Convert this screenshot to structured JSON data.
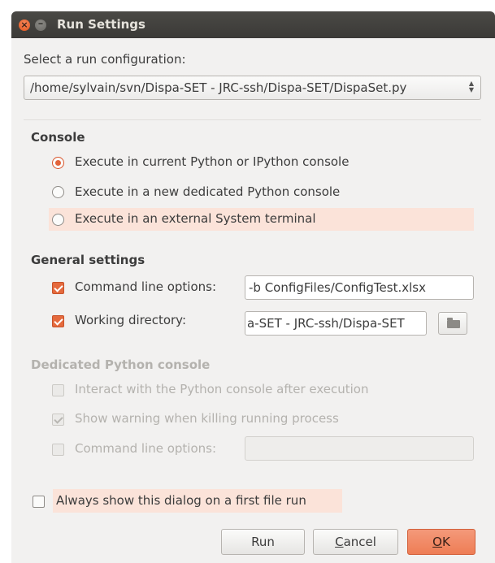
{
  "window": {
    "title": "Run Settings",
    "close_glyph": "×",
    "minimize_glyph": "–"
  },
  "run_config": {
    "label": "Select a run configuration:",
    "selected": "/home/sylvain/svn/Dispa-SET - JRC-ssh/Dispa-SET/DispaSet.py"
  },
  "console": {
    "title": "Console",
    "options": [
      {
        "label": "Execute in current Python or IPython console",
        "checked": true
      },
      {
        "label": "Execute in a new dedicated Python console",
        "checked": false
      },
      {
        "label": "Execute in an external System terminal",
        "checked": false
      }
    ]
  },
  "general": {
    "title": "General settings",
    "cmd_label": "Command line options:",
    "cmd_value": "-b ConfigFiles/ConfigTest.xlsx",
    "wd_label": "Working directory:",
    "wd_value": "a-SET - JRC-ssh/Dispa-SET"
  },
  "dedicated": {
    "title": "Dedicated Python console",
    "interact_label": "Interact with the Python console after execution",
    "warning_label": "Show warning when killing running process",
    "cmd_label": "Command line options:",
    "cmd_value": ""
  },
  "always_show": {
    "label": "Always show this dialog on a first file run"
  },
  "buttons": {
    "run": "Run",
    "cancel_pre": "",
    "cancel_ul": "C",
    "cancel_post": "ancel",
    "ok_pre": "",
    "ok_ul": "O",
    "ok_post": "K"
  },
  "colors": {
    "accent": "#e56a3d",
    "titlebar": "#3c3b37",
    "dialog_bg": "#f2f1f0",
    "highlight": "#fbe3d9"
  },
  "icons": {
    "close": "close-icon",
    "minimize": "minimize-icon",
    "combo_arrows": "updown-arrows-icon",
    "folder": "folder-icon"
  }
}
